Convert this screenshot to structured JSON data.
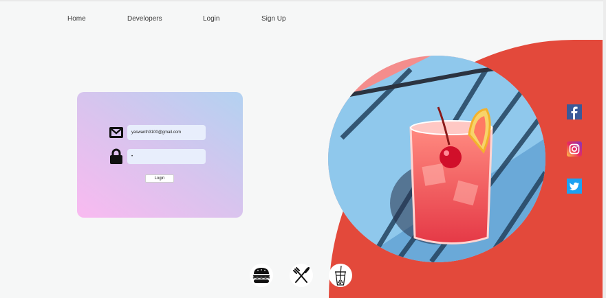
{
  "nav": {
    "items": [
      {
        "label": "Home"
      },
      {
        "label": "Developers"
      },
      {
        "label": "Login"
      },
      {
        "label": "Sign Up"
      }
    ]
  },
  "login": {
    "email_value": "yaswanth3100@gmail.com",
    "password_value": "•",
    "button_label": "Login"
  },
  "social": [
    "facebook-icon",
    "instagram-icon",
    "twitter-icon"
  ],
  "categories": [
    "burger-icon",
    "cutlery-icon",
    "drink-cup-icon"
  ],
  "colors": {
    "accent_red": "#e3493b",
    "facebook": "#3b5998",
    "twitter": "#1da1f2",
    "background": "#f6f7f7"
  }
}
